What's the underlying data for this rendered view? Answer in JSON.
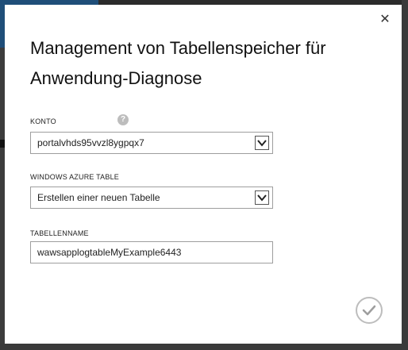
{
  "dialog": {
    "title": "Management von Tabellenspeicher für Anwendung-Diagnose",
    "close_icon": "close-icon",
    "confirm_icon": "checkmark-icon"
  },
  "fields": {
    "konto": {
      "label": "KONTO",
      "value": "portalvhds95vvzl8ygpqx7",
      "help_icon": "question-mark-icon",
      "help_glyph": "?"
    },
    "table": {
      "label": "WINDOWS AZURE TABLE",
      "value": "Erstellen einer neuen Tabelle"
    },
    "tablename": {
      "label": "TABELLENNAME",
      "value": "wawsapplogtableMyExample6443"
    }
  },
  "colors": {
    "overlay": "#2b2b2b",
    "dialog_bg": "#ffffff",
    "border": "#9e9e9e",
    "confirm_ring": "#bdbdbd"
  }
}
